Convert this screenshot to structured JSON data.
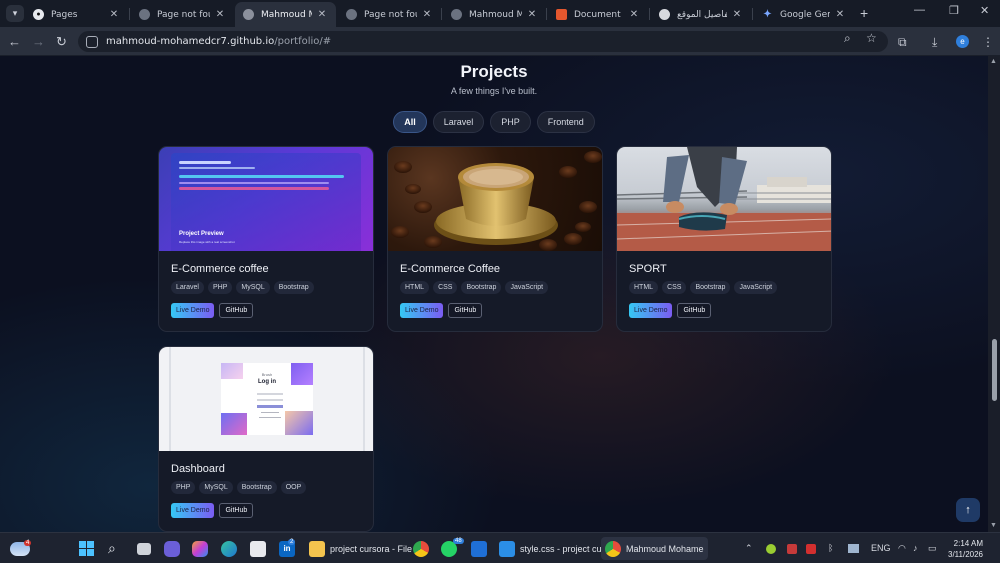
{
  "browser": {
    "tabs": [
      {
        "title": "Pages",
        "favicon": "github-icon",
        "active": false
      },
      {
        "title": "Page not found",
        "favicon": "globe-icon",
        "active": false
      },
      {
        "title": "Mahmoud Mohame",
        "favicon": "globe-icon",
        "active": true
      },
      {
        "title": "Page not found",
        "favicon": "globe-icon",
        "active": false
      },
      {
        "title": "Mahmoud Moh",
        "favicon": "globe-icon",
        "active": false
      },
      {
        "title": "Document",
        "favicon": "html-icon",
        "active": false
      },
      {
        "title": "تفاصيل الموقع",
        "favicon": "openai-icon",
        "active": false
      },
      {
        "title": "Google Gemini",
        "favicon": "gemini-icon",
        "active": false
      }
    ],
    "url_host": "mahmoud-mohamedcr7.github.io",
    "url_path": "/portfolio/#",
    "profile_initial": "e"
  },
  "page": {
    "title": "Projects",
    "subtitle": "A few things I've built.",
    "filters": [
      {
        "label": "All",
        "active": true
      },
      {
        "label": "Laravel",
        "active": false
      },
      {
        "label": "PHP",
        "active": false
      },
      {
        "label": "Frontend",
        "active": false
      }
    ],
    "projects": [
      {
        "title": "E-Commerce coffee",
        "thumb": "preview",
        "preview_title": "Project Preview",
        "preview_caption": "Replace this image with a real screenshot",
        "tags": [
          "Laravel",
          "PHP",
          "MySQL",
          "Bootstrap"
        ],
        "demo_label": "Live Demo",
        "github_label": "GitHub"
      },
      {
        "title": "E-Commerce Coffee",
        "thumb": "coffee",
        "tags": [
          "HTML",
          "CSS",
          "Bootstrap",
          "JavaScript"
        ],
        "demo_label": "Live Demo",
        "github_label": "GitHub"
      },
      {
        "title": "SPORT",
        "thumb": "sport",
        "tags": [
          "HTML",
          "CSS",
          "Bootstrap",
          "JavaScript"
        ],
        "demo_label": "Live Demo",
        "github_label": "GitHub"
      },
      {
        "title": "Dashboard",
        "thumb": "login",
        "login_brand": "Brush",
        "login_title": "Log in",
        "tags": [
          "PHP",
          "MySQL",
          "Bootstrap",
          "OOP"
        ],
        "demo_label": "Live Demo",
        "github_label": "GitHub"
      }
    ]
  },
  "taskbar": {
    "weather_badge": "4",
    "linkedin_badge": "2",
    "whatsapp_badge": "48",
    "apps": [
      {
        "label": "project cursora - File",
        "icon": "folder-icon"
      },
      {
        "label": "style.css - project cu",
        "icon": "vscode-icon"
      },
      {
        "label": "Mahmoud Mohame",
        "icon": "chrome-icon"
      }
    ],
    "lang": "ENG",
    "time": "2:14 AM",
    "date": "3/11/2026"
  },
  "colors": {
    "accent": "#3a5688",
    "demo_gradient_start": "#35c8f3",
    "demo_gradient_end": "#7b5cf2"
  }
}
